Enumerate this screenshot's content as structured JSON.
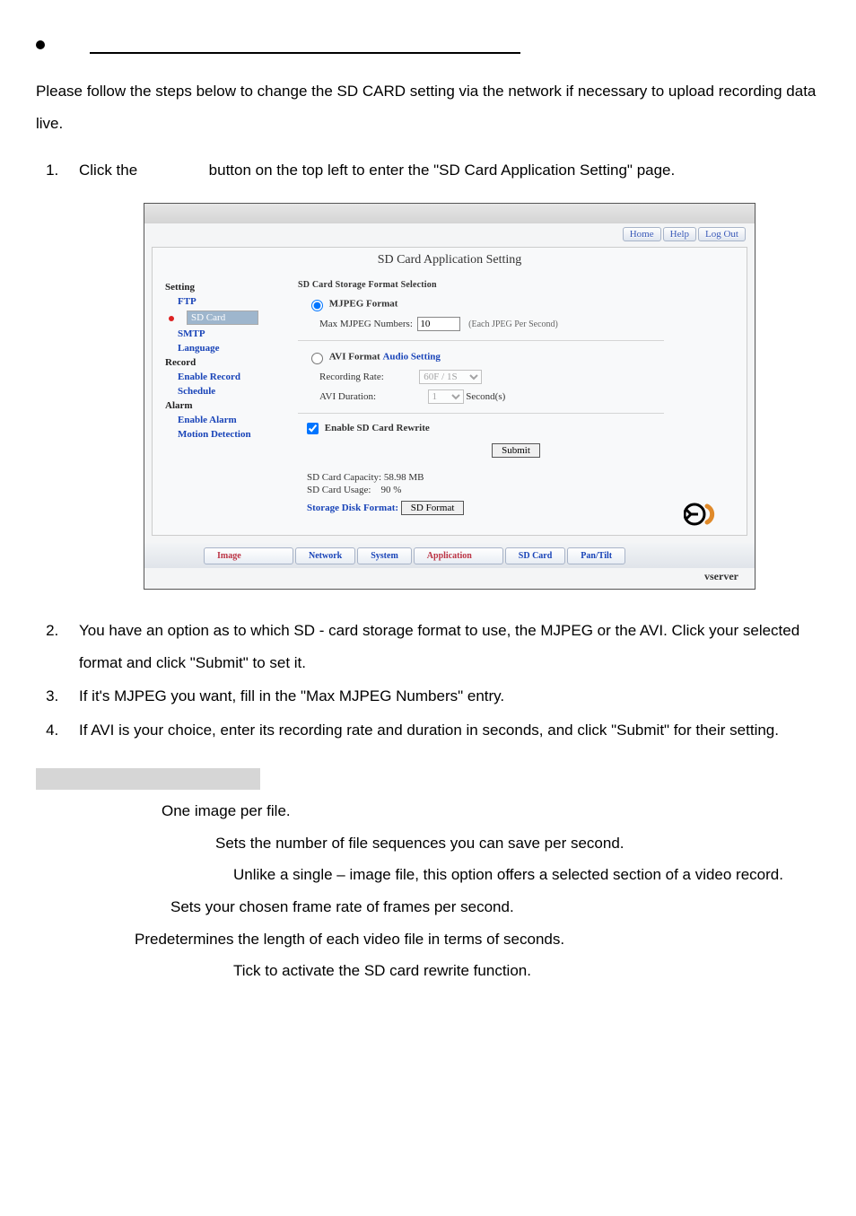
{
  "intro": "Please follow the steps below to change the SD CARD setting via the network if necessary to upload recording data live.",
  "steps": {
    "s1a": "Click the",
    "s1b": "button on the top left to enter the \"SD Card Application Setting\" page.",
    "s2": "You have an option as to which SD - card storage format to use, the MJPEG or the AVI. Click your selected format and click \"Submit\" to set it.",
    "s3": "If it's MJPEG you want, fill in the \"Max MJPEG Numbers\" entry.",
    "s4": "If AVI is your choice, enter its recording rate and duration in seconds, and click \"Submit\" for their setting."
  },
  "topnav": {
    "home": "Home",
    "help": "Help",
    "logout": "Log Out"
  },
  "page_title": "SD Card Application Setting",
  "sidebar": {
    "setting": "Setting",
    "ftp": "FTP",
    "sdcard": "SD Card",
    "smtp": "SMTP",
    "language": "Language",
    "record": "Record",
    "enable_record": "Enable Record",
    "schedule": "Schedule",
    "alarm": "Alarm",
    "enable_alarm": "Enable Alarm",
    "motion": "Motion Detection"
  },
  "content": {
    "section": "SD Card Storage Format Selection",
    "mjpeg": "MJPEG Format",
    "max_lbl": "Max MJPEG Numbers:",
    "max_val": "10",
    "max_hint": "(Each JPEG Per Second)",
    "avi": "AVI Format",
    "audio": "Audio Setting",
    "rec_lbl": "Recording Rate:",
    "rec_val": "60F / 1S",
    "dur_lbl": "AVI Duration:",
    "dur_val": "1",
    "dur_unit": "Second(s)",
    "rewrite": "Enable SD Card Rewrite",
    "submit": "Submit",
    "cap_lbl": "SD Card Capacity:",
    "cap_val": "58.98 MB",
    "use_lbl": "SD Card Usage:",
    "use_val": "90 %",
    "stg_lbl": "Storage Disk Format:",
    "stg_btn": "SD Format"
  },
  "tabs": {
    "image": "Image",
    "network": "Network",
    "system": "System",
    "application": "Application",
    "sdcard": "SD Card",
    "pantilt": "Pan/Tilt"
  },
  "brand": "vserver",
  "defs": {
    "d1": "One image per file.",
    "d2": "Sets the number of file sequences you can save per second.",
    "d3": "Unlike a single – image file, this option offers a selected section of a video record.",
    "d4": "Sets your chosen frame rate of frames per second.",
    "d5": "Predetermines the length of each video file in terms of seconds.",
    "d6": "Tick to activate the SD card rewrite function."
  }
}
